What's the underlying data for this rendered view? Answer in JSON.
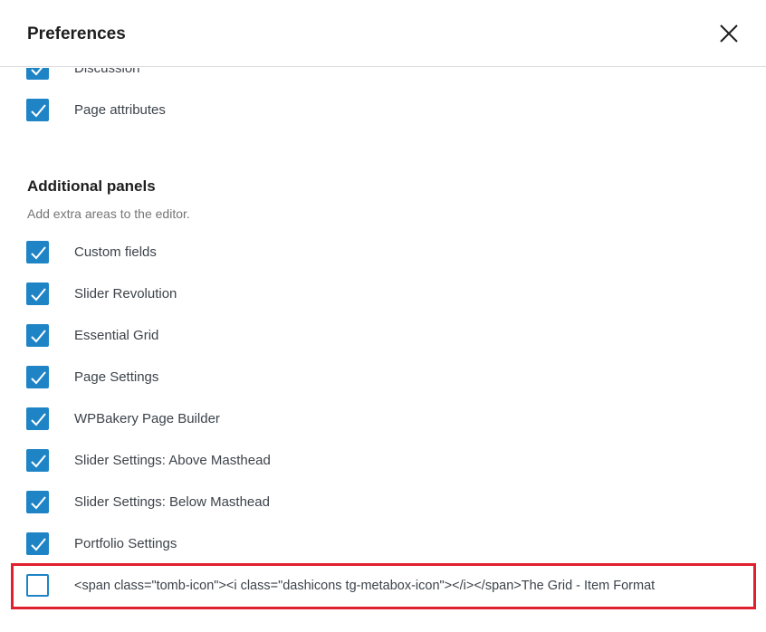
{
  "modal": {
    "title": "Preferences",
    "close_icon": "close-icon"
  },
  "panels_top": [
    {
      "label": "Discussion",
      "checked": true
    },
    {
      "label": "Page attributes",
      "checked": true
    }
  ],
  "additional_panels": {
    "title": "Additional panels",
    "description": "Add extra areas to the editor.",
    "items": [
      {
        "label": "Custom fields",
        "checked": true
      },
      {
        "label": "Slider Revolution",
        "checked": true
      },
      {
        "label": "Essential Grid",
        "checked": true
      },
      {
        "label": "Page Settings",
        "checked": true
      },
      {
        "label": "WPBakery Page Builder",
        "checked": true
      },
      {
        "label": "Slider Settings: Above Masthead",
        "checked": true
      },
      {
        "label": "Slider Settings: Below Masthead",
        "checked": true
      },
      {
        "label": "Portfolio Settings",
        "checked": true
      },
      {
        "label": "<span class=\"tomb-icon\"><i class=\"dashicons tg-metabox-icon\"></i></span>The Grid - Item Format",
        "checked": false
      }
    ]
  },
  "colors": {
    "checkbox_blue": "#1e84c6",
    "highlight_red": "#e0202f"
  }
}
